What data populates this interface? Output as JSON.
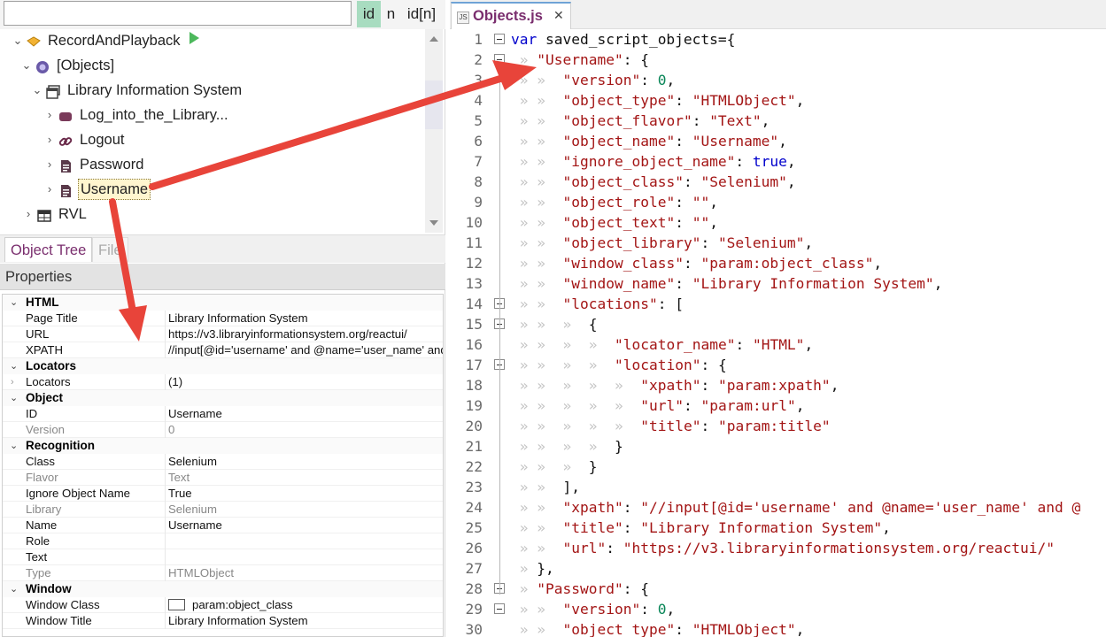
{
  "search": {
    "value": "",
    "mode_id": "id",
    "mode_n": "n",
    "mode_idn": "id[n]"
  },
  "tree": {
    "nodes": [
      {
        "label": "RecordAndPlayback",
        "icon": "diamond-icon"
      },
      {
        "label": "[Objects]",
        "icon": "objects-icon"
      },
      {
        "label": "Library Information System",
        "icon": "window-icon"
      },
      {
        "label": "Log_into_the_Library...",
        "icon": "button-icon"
      },
      {
        "label": "Logout",
        "icon": "link-icon"
      },
      {
        "label": "Password",
        "icon": "textbox-icon"
      },
      {
        "label": "Username",
        "icon": "textbox-icon"
      },
      {
        "label": "RVL",
        "icon": "table-icon"
      }
    ]
  },
  "tabs": {
    "object_tree": "Object Tree",
    "file": "File"
  },
  "properties": {
    "header": "Properties",
    "html": {
      "cat": "HTML",
      "page_title_k": "Page Title",
      "page_title_v": "Library Information System",
      "url_k": "URL",
      "url_v": "https://v3.libraryinformationsystem.org/reactui/",
      "xpath_k": "XPATH",
      "xpath_v": "//input[@id='username' and @name='user_name' and"
    },
    "locators": {
      "cat": "Locators",
      "k": "Locators",
      "v": "(1)"
    },
    "object": {
      "cat": "Object",
      "id_k": "ID",
      "id_v": "Username",
      "version_k": "Version",
      "version_v": "0"
    },
    "recognition": {
      "cat": "Recognition",
      "class_k": "Class",
      "class_v": "Selenium",
      "flavor_k": "Flavor",
      "flavor_v": "Text",
      "ignore_k": "Ignore Object Name",
      "ignore_v": "True",
      "library_k": "Library",
      "library_v": "Selenium",
      "name_k": "Name",
      "name_v": "Username",
      "role_k": "Role",
      "role_v": "",
      "text_k": "Text",
      "text_v": "",
      "type_k": "Type",
      "type_v": "HTMLObject"
    },
    "window": {
      "cat": "Window",
      "class_k": "Window Class",
      "class_v": "param:object_class",
      "title_k": "Window Title",
      "title_v": "Library Information System"
    }
  },
  "editor": {
    "tab_title": "Objects.js",
    "js_badge": "JS",
    "close_glyph": "✕",
    "lines": [
      {
        "n": "1",
        "d": 0,
        "s": [
          [
            "k",
            "var"
          ],
          [
            "p",
            " saved_script_objects={"
          ]
        ]
      },
      {
        "n": "2",
        "d": 1,
        "s": [
          [
            "s",
            "\"Username\""
          ],
          [
            "p",
            ": {"
          ]
        ]
      },
      {
        "n": "3",
        "d": 2,
        "s": [
          [
            "s",
            "\"version\""
          ],
          [
            "p",
            ": "
          ],
          [
            "n",
            "0"
          ],
          [
            "p",
            ","
          ]
        ]
      },
      {
        "n": "4",
        "d": 2,
        "s": [
          [
            "s",
            "\"object_type\""
          ],
          [
            "p",
            ": "
          ],
          [
            "s",
            "\"HTMLObject\""
          ],
          [
            "p",
            ","
          ]
        ]
      },
      {
        "n": "5",
        "d": 2,
        "s": [
          [
            "s",
            "\"object_flavor\""
          ],
          [
            "p",
            ": "
          ],
          [
            "s",
            "\"Text\""
          ],
          [
            "p",
            ","
          ]
        ]
      },
      {
        "n": "6",
        "d": 2,
        "s": [
          [
            "s",
            "\"object_name\""
          ],
          [
            "p",
            ": "
          ],
          [
            "s",
            "\"Username\""
          ],
          [
            "p",
            ","
          ]
        ]
      },
      {
        "n": "7",
        "d": 2,
        "s": [
          [
            "s",
            "\"ignore_object_name\""
          ],
          [
            "p",
            ": "
          ],
          [
            "b",
            "true"
          ],
          [
            "p",
            ","
          ]
        ]
      },
      {
        "n": "8",
        "d": 2,
        "s": [
          [
            "s",
            "\"object_class\""
          ],
          [
            "p",
            ": "
          ],
          [
            "s",
            "\"Selenium\""
          ],
          [
            "p",
            ","
          ]
        ]
      },
      {
        "n": "9",
        "d": 2,
        "s": [
          [
            "s",
            "\"object_role\""
          ],
          [
            "p",
            ": "
          ],
          [
            "s",
            "\"\""
          ],
          [
            "p",
            ","
          ]
        ]
      },
      {
        "n": "10",
        "d": 2,
        "s": [
          [
            "s",
            "\"object_text\""
          ],
          [
            "p",
            ": "
          ],
          [
            "s",
            "\"\""
          ],
          [
            "p",
            ","
          ]
        ]
      },
      {
        "n": "11",
        "d": 2,
        "s": [
          [
            "s",
            "\"object_library\""
          ],
          [
            "p",
            ": "
          ],
          [
            "s",
            "\"Selenium\""
          ],
          [
            "p",
            ","
          ]
        ]
      },
      {
        "n": "12",
        "d": 2,
        "s": [
          [
            "s",
            "\"window_class\""
          ],
          [
            "p",
            ": "
          ],
          [
            "s",
            "\"param:object_class\""
          ],
          [
            "p",
            ","
          ]
        ]
      },
      {
        "n": "13",
        "d": 2,
        "s": [
          [
            "s",
            "\"window_name\""
          ],
          [
            "p",
            ": "
          ],
          [
            "s",
            "\"Library Information System\""
          ],
          [
            "p",
            ","
          ]
        ]
      },
      {
        "n": "14",
        "d": 2,
        "s": [
          [
            "s",
            "\"locations\""
          ],
          [
            "p",
            ": ["
          ]
        ]
      },
      {
        "n": "15",
        "d": 3,
        "s": [
          [
            "p",
            "{"
          ]
        ]
      },
      {
        "n": "16",
        "d": 4,
        "s": [
          [
            "s",
            "\"locator_name\""
          ],
          [
            "p",
            ": "
          ],
          [
            "s",
            "\"HTML\""
          ],
          [
            "p",
            ","
          ]
        ]
      },
      {
        "n": "17",
        "d": 4,
        "s": [
          [
            "s",
            "\"location\""
          ],
          [
            "p",
            ": {"
          ]
        ]
      },
      {
        "n": "18",
        "d": 5,
        "s": [
          [
            "s",
            "\"xpath\""
          ],
          [
            "p",
            ": "
          ],
          [
            "s",
            "\"param:xpath\""
          ],
          [
            "p",
            ","
          ]
        ]
      },
      {
        "n": "19",
        "d": 5,
        "s": [
          [
            "s",
            "\"url\""
          ],
          [
            "p",
            ": "
          ],
          [
            "s",
            "\"param:url\""
          ],
          [
            "p",
            ","
          ]
        ]
      },
      {
        "n": "20",
        "d": 5,
        "s": [
          [
            "s",
            "\"title\""
          ],
          [
            "p",
            ": "
          ],
          [
            "s",
            "\"param:title\""
          ]
        ]
      },
      {
        "n": "21",
        "d": 4,
        "s": [
          [
            "p",
            "}"
          ]
        ]
      },
      {
        "n": "22",
        "d": 3,
        "s": [
          [
            "p",
            "}"
          ]
        ]
      },
      {
        "n": "23",
        "d": 2,
        "s": [
          [
            "p",
            "],"
          ]
        ]
      },
      {
        "n": "24",
        "d": 2,
        "s": [
          [
            "s",
            "\"xpath\""
          ],
          [
            "p",
            ": "
          ],
          [
            "s",
            "\"//input[@id='username' and @name='user_name' and @"
          ]
        ]
      },
      {
        "n": "25",
        "d": 2,
        "s": [
          [
            "s",
            "\"title\""
          ],
          [
            "p",
            ": "
          ],
          [
            "s",
            "\"Library Information System\""
          ],
          [
            "p",
            ","
          ]
        ]
      },
      {
        "n": "26",
        "d": 2,
        "s": [
          [
            "s",
            "\"url\""
          ],
          [
            "p",
            ": "
          ],
          [
            "s",
            "\"https://v3.libraryinformationsystem.org/reactui/\""
          ]
        ]
      },
      {
        "n": "27",
        "d": 1,
        "s": [
          [
            "p",
            "},"
          ]
        ]
      },
      {
        "n": "28",
        "d": 1,
        "s": [
          [
            "s",
            "\"Password\""
          ],
          [
            "p",
            ": {"
          ]
        ]
      },
      {
        "n": "29",
        "d": 2,
        "s": [
          [
            "s",
            "\"version\""
          ],
          [
            "p",
            ": "
          ],
          [
            "n",
            "0"
          ],
          [
            "p",
            ","
          ]
        ]
      },
      {
        "n": "30",
        "d": 2,
        "s": [
          [
            "s",
            "\"object_type\""
          ],
          [
            "p",
            ": "
          ],
          [
            "s",
            "\"HTMLObject\""
          ],
          [
            "p",
            ","
          ]
        ]
      }
    ]
  },
  "colors": {
    "accent_purple": "#7a2e6e",
    "arrow_red": "#e8443a",
    "search_mode_active": "#a8dcc0",
    "string": "#a31515",
    "keyword": "#0000cc"
  }
}
